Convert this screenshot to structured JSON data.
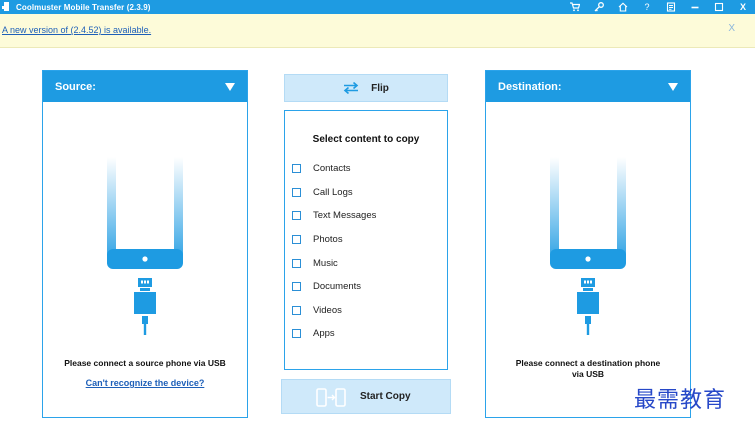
{
  "window": {
    "title": "Coolmuster Mobile Transfer (2.3.9)",
    "controls": [
      "cart-icon",
      "key-icon",
      "home-icon",
      "help-icon",
      "feedback-icon",
      "minimize-icon",
      "maximize-icon",
      "close-icon"
    ],
    "help_glyph": "?",
    "close_glyph": "X"
  },
  "update_banner": {
    "text": "A new version of (2.4.52) is available.",
    "close_glyph": "X"
  },
  "source": {
    "title": "Source:",
    "message": "Please connect a source phone via USB",
    "link": "Can't recognize the device?"
  },
  "destination": {
    "title": "Destination:",
    "message_line1": "Please connect a destination phone",
    "message_line2": "via USB"
  },
  "flip": {
    "label": "Flip"
  },
  "content": {
    "title": "Select content to copy",
    "items": [
      "Contacts",
      "Call Logs",
      "Text Messages",
      "Photos",
      "Music",
      "Documents",
      "Videos",
      "Apps"
    ]
  },
  "start_copy": {
    "label": "Start Copy"
  },
  "watermark": {
    "text": "最需教育"
  },
  "colors": {
    "accent": "#1e9be2",
    "light_accent": "#cfe9fa",
    "banner_bg": "#fdfbd9",
    "link": "#1d5fb8"
  }
}
